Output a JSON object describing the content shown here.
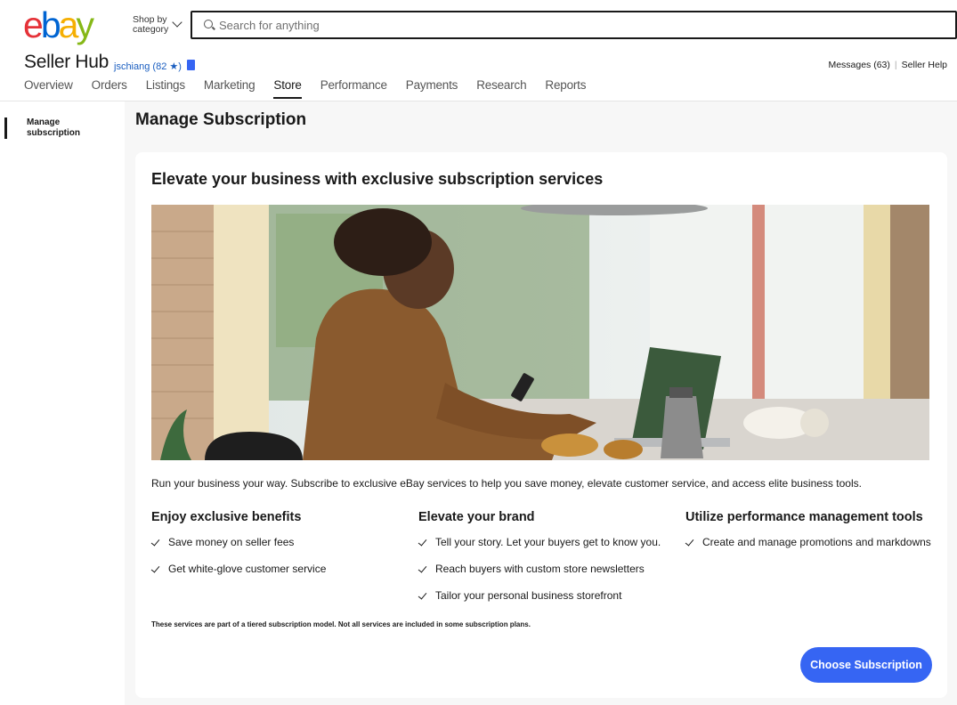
{
  "header": {
    "logo_letters": [
      {
        "char": "e",
        "color": "#e53238"
      },
      {
        "char": "b",
        "color": "#0064d2"
      },
      {
        "char": "a",
        "color": "#f5af02"
      },
      {
        "char": "y",
        "color": "#86b817"
      }
    ],
    "shop_by_line1": "Shop by",
    "shop_by_line2": "category",
    "search_placeholder": "Search for anything",
    "hub_title": "Seller Hub",
    "username": "jschiang",
    "feedback": "(82 ★)",
    "messages": "Messages (63)",
    "separator": "|",
    "seller_help": "Seller Help"
  },
  "nav": {
    "tabs": [
      {
        "label": "Overview",
        "active": false
      },
      {
        "label": "Orders",
        "active": false
      },
      {
        "label": "Listings",
        "active": false
      },
      {
        "label": "Marketing",
        "active": false
      },
      {
        "label": "Store",
        "active": true
      },
      {
        "label": "Performance",
        "active": false
      },
      {
        "label": "Payments",
        "active": false
      },
      {
        "label": "Research",
        "active": false
      },
      {
        "label": "Reports",
        "active": false
      }
    ]
  },
  "sidebar": {
    "items": [
      {
        "line1": "Manage",
        "line2": "subscription",
        "active": true
      }
    ]
  },
  "main": {
    "page_title": "Manage Subscription",
    "card_title": "Elevate your business with exclusive subscription services",
    "intro": "Run your business your way. Subscribe to exclusive eBay services to help you save money, elevate customer service, and access elite business tools.",
    "columns": [
      {
        "heading": "Enjoy exclusive benefits",
        "items": [
          "Save money on seller fees",
          "Get white-glove customer service"
        ]
      },
      {
        "heading": "Elevate your brand",
        "items": [
          "Tell your story. Let your buyers get to know you.",
          "Reach buyers with custom store newsletters",
          "Tailor your personal business storefront"
        ]
      },
      {
        "heading": "Utilize performance management tools",
        "items": [
          "Create and manage promotions and markdowns"
        ]
      }
    ],
    "disclaimer": "These services are part of a tiered subscription model. Not all services are included in some subscription plans.",
    "cta_label": "Choose Subscription"
  },
  "colors": {
    "accent": "#3665f3",
    "link": "#1a5ec0"
  }
}
